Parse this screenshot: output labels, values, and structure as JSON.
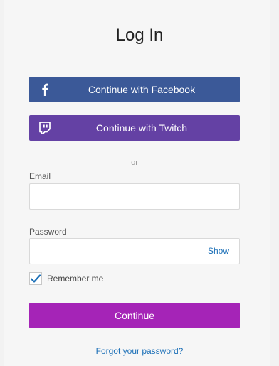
{
  "page": {
    "title": "Log In"
  },
  "social": {
    "facebook": {
      "label": "Continue with Facebook",
      "icon": "facebook-icon",
      "color": "#3b5998"
    },
    "twitch": {
      "label": "Continue with Twitch",
      "icon": "twitch-icon",
      "color": "#6441a4"
    }
  },
  "divider": {
    "text": "or"
  },
  "form": {
    "email": {
      "label": "Email",
      "value": "",
      "placeholder": ""
    },
    "password": {
      "label": "Password",
      "value": "",
      "placeholder": "",
      "show_label": "Show"
    },
    "remember": {
      "label": "Remember me",
      "checked": true
    },
    "submit_label": "Continue",
    "submit_color": "#a524b7"
  },
  "links": {
    "forgot_password": "Forgot your password?",
    "link_color": "#1b6fb7"
  }
}
